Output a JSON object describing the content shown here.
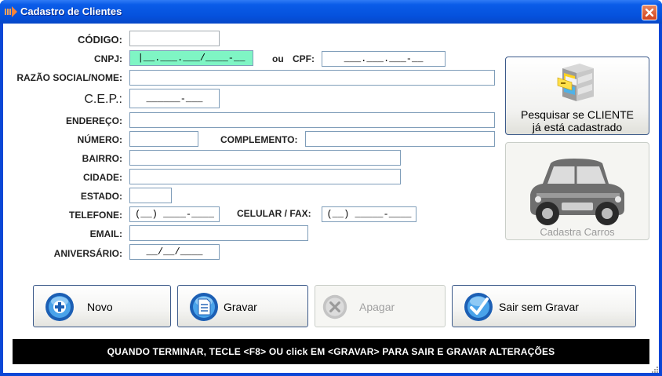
{
  "window": {
    "title": "Cadastro de Clientes"
  },
  "form": {
    "codigo": {
      "label": "CÓDIGO:",
      "value": ""
    },
    "cnpj": {
      "label": "CNPJ:",
      "mask": "|__.___.___/____-__"
    },
    "ou": "ou",
    "cpf": {
      "label": "CPF:",
      "mask": "___.___.___-__"
    },
    "razao": {
      "label": "RAZÃO SOCIAL/NOME:",
      "value": ""
    },
    "cep": {
      "label": "C.E.P.:",
      "mask": "______-___"
    },
    "endereco": {
      "label": "ENDEREÇO:",
      "value": ""
    },
    "numero": {
      "label": "NÚMERO:",
      "value": ""
    },
    "complemento": {
      "label": "COMPLEMENTO:",
      "value": ""
    },
    "bairro": {
      "label": "BAIRRO:",
      "value": ""
    },
    "cidade": {
      "label": "CIDADE:",
      "value": ""
    },
    "estado": {
      "label": "ESTADO:",
      "value": ""
    },
    "telefone": {
      "label": "TELEFONE:",
      "mask": "(__) ____-____"
    },
    "celular": {
      "label": "CELULAR / FAX:",
      "mask": "(__) _____-____"
    },
    "email": {
      "label": "EMAIL:",
      "value": ""
    },
    "aniversario": {
      "label": "ANIVERSÁRIO:",
      "mask": "__/__/____"
    }
  },
  "side": {
    "pesquisar_line1": "Pesquisar se CLIENTE",
    "pesquisar_line2": "já está cadastrado",
    "cadastra_carros": "Cadastra Carros"
  },
  "actions": {
    "novo": "Novo",
    "gravar": "Gravar",
    "apagar": "Apagar",
    "sair": "Sair sem Gravar"
  },
  "status": "QUANDO TERMINAR, TECLE <F8> OU click EM <GRAVAR> PARA SAIR E GRAVAR ALTERAÇÕES",
  "icons": {
    "title": "arrow-icon",
    "close": "close-icon",
    "pesquisar": "file-cabinet-icon",
    "carros": "car-icon",
    "novo": "plus-icon",
    "gravar": "document-icon",
    "apagar": "x-icon",
    "sair": "checkmark-icon"
  },
  "colors": {
    "titlebar": "#0551dc",
    "cnpj_field": "#7ff5c4",
    "status_bg": "#000000",
    "close": "#d2421c"
  }
}
